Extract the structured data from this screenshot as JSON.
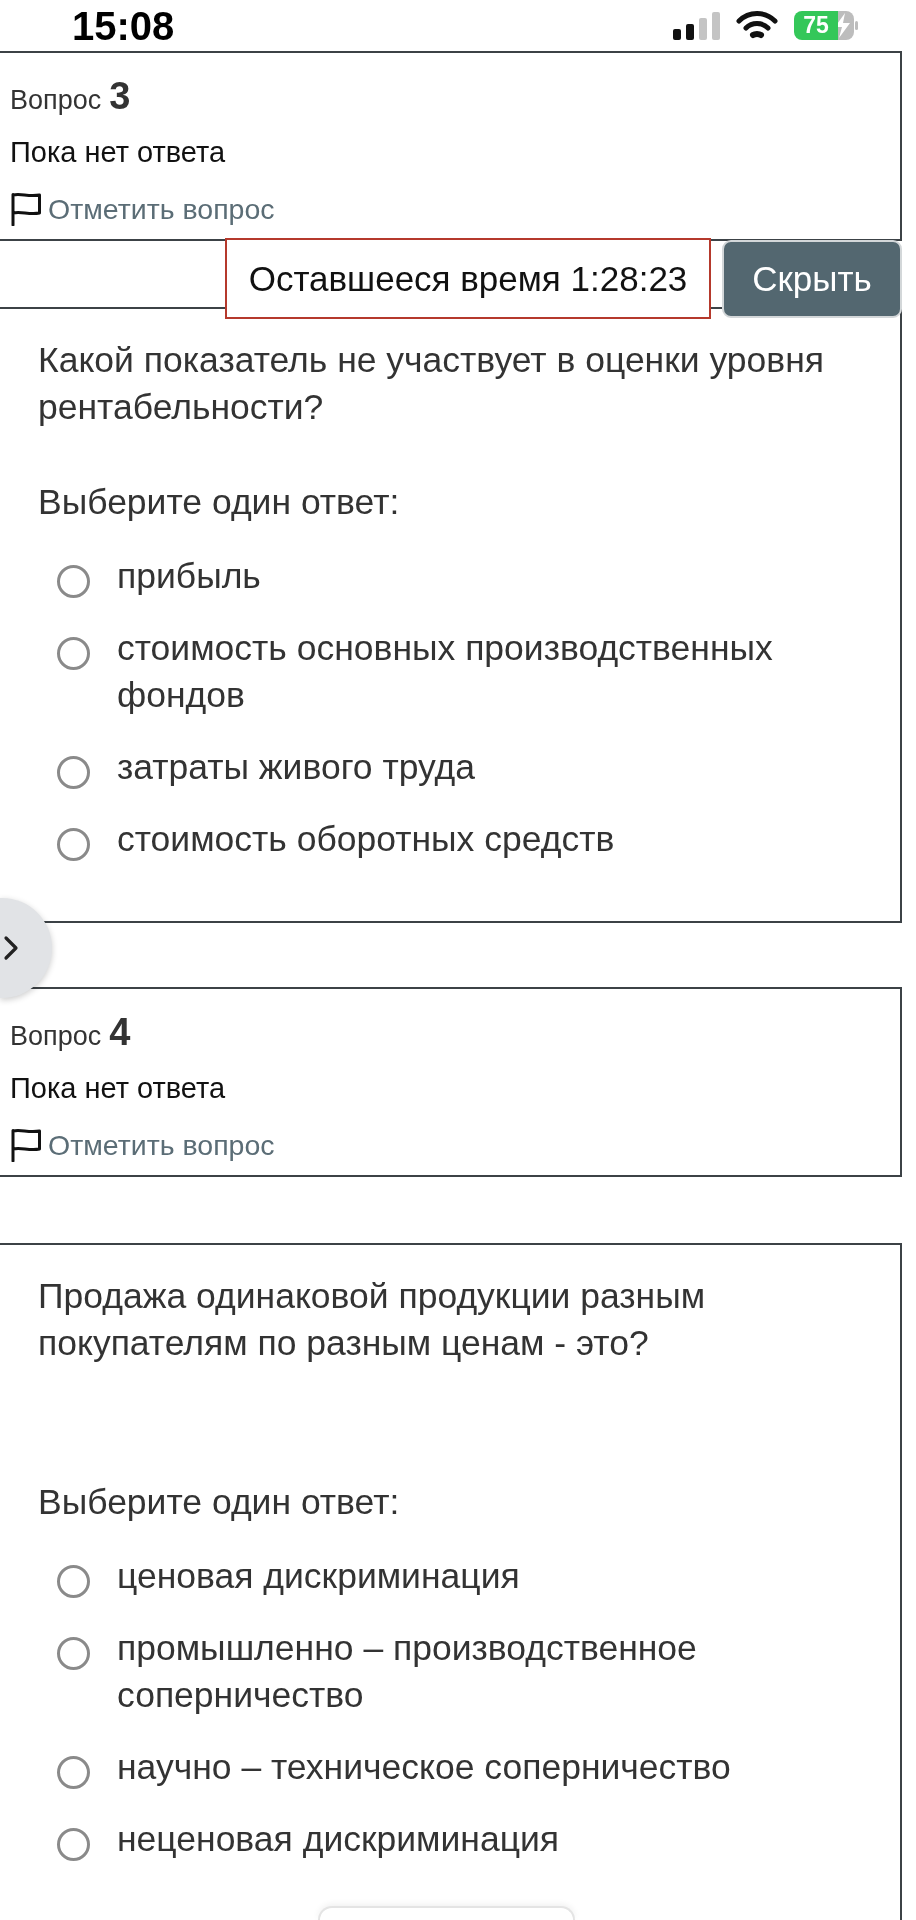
{
  "status_bar": {
    "time": "15:08",
    "battery": "75"
  },
  "timer": {
    "text": "Оставшееся время 1:28:23",
    "hide_button": "Скрыть"
  },
  "questions": [
    {
      "label": "Вопрос",
      "number": "3",
      "state": "Пока нет ответа",
      "flag_link": "Отметить вопрос",
      "text": "Какой показатель не участвует в оценки уровня рентабельности?",
      "prompt": "Выберите один ответ:",
      "options": [
        {
          "label": "прибыль",
          "selected": false
        },
        {
          "label": "стоимость основных производственных фондов",
          "selected": false
        },
        {
          "label": "затраты живого труда",
          "selected": false
        },
        {
          "label": "стоимость оборотных средств",
          "selected": false
        }
      ]
    },
    {
      "label": "Вопрос",
      "number": "4",
      "state": "Пока нет ответа",
      "flag_link": "Отметить вопрос",
      "text": "Продажа одинаковой продукции разным покупателям по разным ценам - это?",
      "prompt": "Выберите один ответ:",
      "options": [
        {
          "label": "ценовая дискриминация",
          "selected": false
        },
        {
          "label": "промышленно – производственное соперничество",
          "selected": false
        },
        {
          "label": "научно – техническое соперничество",
          "selected": false
        },
        {
          "label": "неценовая дискриминация",
          "selected": false
        }
      ]
    }
  ]
}
